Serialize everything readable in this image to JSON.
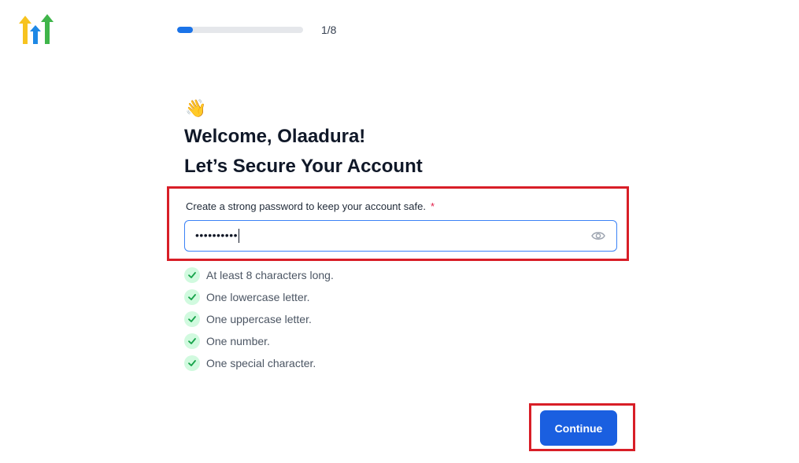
{
  "app": {
    "logo_icon": "gohighlevel-arrows-logo"
  },
  "progress": {
    "step_label": "1/8",
    "fraction": 0.125,
    "fill_color": "#1a73e8"
  },
  "header": {
    "wave_emoji": "👋",
    "welcome": "Welcome, Olaadura!",
    "heading": "Let’s Secure Your Account"
  },
  "password": {
    "label": "Create a strong password to keep your account safe.",
    "required_marker": "*",
    "masked_value": "••••••••••",
    "toggle_icon": "eye-icon"
  },
  "requirements": [
    {
      "text": "At least 8 characters long.",
      "met": true
    },
    {
      "text": "One lowercase letter.",
      "met": true
    },
    {
      "text": "One uppercase letter.",
      "met": true
    },
    {
      "text": "One number.",
      "met": true
    },
    {
      "text": "One special character.",
      "met": true
    }
  ],
  "actions": {
    "continue_label": "Continue",
    "primary_color": "#1a5fe0"
  },
  "annotations": {
    "highlight_color": "#d81e27"
  }
}
